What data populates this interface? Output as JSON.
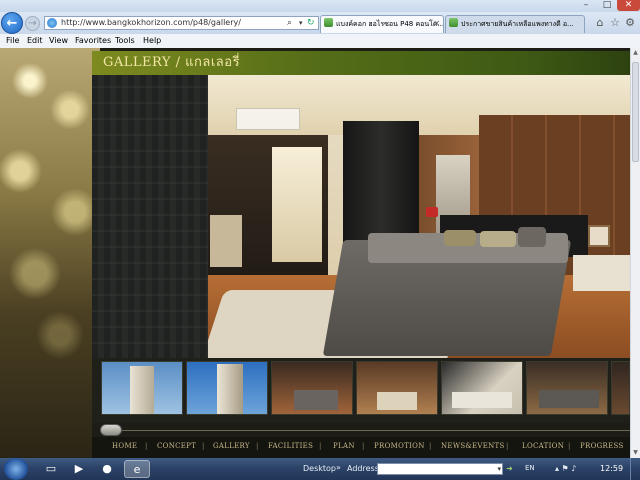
{
  "browser": {
    "url": "http://www.bangkokhorizon.com/p48/gallery/",
    "tabs": [
      {
        "label": "แบงค์คอก ฮอไรซอน P48 คอนโด..."
      },
      {
        "label": "ประกาศขายสินค้าเหลือแพงทางดี อ..."
      }
    ],
    "menu": [
      "File",
      "Edit",
      "View",
      "Favorites",
      "Tools",
      "Help"
    ],
    "window_buttons": {
      "min": "–",
      "max": "□",
      "close": "✕"
    },
    "icons": {
      "back": "arrow-left-icon",
      "forward": "arrow-right-icon",
      "search": "search-icon",
      "refresh": "refresh-icon"
    }
  },
  "page": {
    "title": "GALLERY / แกลเลอรี่",
    "nav": [
      "HOME",
      "CONCEPT",
      "GALLERY",
      "FACILITIES",
      "PLAN",
      "PROMOTION",
      "NEWS&EVENTS",
      "LOCATION",
      "PROGRESS"
    ],
    "nav_separator": "|"
  },
  "taskbar": {
    "desktop_label": "Desktop",
    "address_label": "Address",
    "language": "EN",
    "clock": "12:59"
  }
}
